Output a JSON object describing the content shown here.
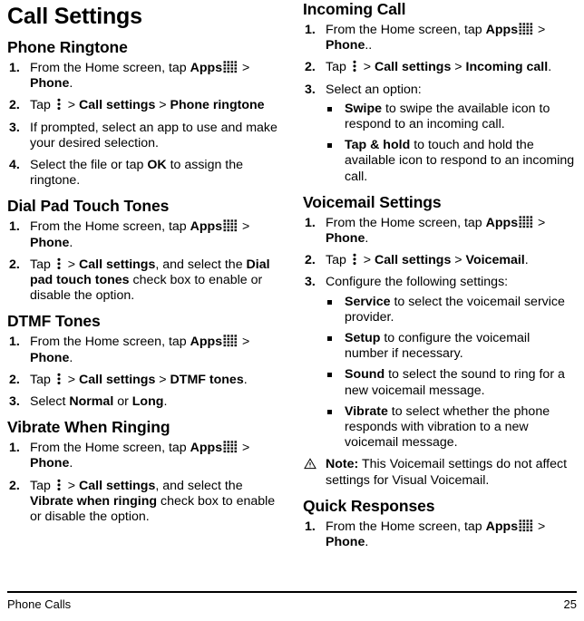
{
  "document": {
    "title": "Call Settings",
    "footer_left": "Phone Calls",
    "footer_page": "25"
  },
  "icons": {
    "apps": "apps-grid-icon",
    "menu": "overflow-menu-icon",
    "note": "warning-triangle-icon"
  },
  "left_column": {
    "sections": [
      {
        "heading": "Phone Ringtone",
        "steps": [
          {
            "num": "1.",
            "parts": [
              {
                "t": "From the Home screen, tap ",
                "b": false
              },
              {
                "t": "Apps",
                "b": true
              },
              {
                "icon": "apps"
              },
              {
                "t": " > ",
                "b": false
              },
              {
                "t": "Phone",
                "b": true
              },
              {
                "t": ".",
                "b": false
              }
            ]
          },
          {
            "num": "2.",
            "parts": [
              {
                "t": "Tap ",
                "b": false
              },
              {
                "icon": "menu"
              },
              {
                "t": " > ",
                "b": false
              },
              {
                "t": "Call settings",
                "b": true
              },
              {
                "t": " > ",
                "b": false
              },
              {
                "t": "Phone ringtone",
                "b": true
              }
            ]
          },
          {
            "num": "3.",
            "parts": [
              {
                "t": "If prompted, select an app to use and make your desired selection.",
                "b": false
              }
            ]
          },
          {
            "num": "4.",
            "parts": [
              {
                "t": "Select the file or tap ",
                "b": false
              },
              {
                "t": "OK",
                "b": true
              },
              {
                "t": " to assign the ringtone.",
                "b": false
              }
            ]
          }
        ]
      },
      {
        "heading": "Dial Pad Touch Tones",
        "steps": [
          {
            "num": "1.",
            "parts": [
              {
                "t": "From the Home screen, tap ",
                "b": false
              },
              {
                "t": "Apps",
                "b": true
              },
              {
                "icon": "apps"
              },
              {
                "t": " > ",
                "b": false
              },
              {
                "t": "Phone",
                "b": true
              },
              {
                "t": ".",
                "b": false
              }
            ]
          },
          {
            "num": "2.",
            "parts": [
              {
                "t": "Tap ",
                "b": false
              },
              {
                "icon": "menu"
              },
              {
                "t": " > ",
                "b": false
              },
              {
                "t": "Call settings",
                "b": true
              },
              {
                "t": ", and select the ",
                "b": false
              },
              {
                "t": "Dial pad touch tones",
                "b": true
              },
              {
                "t": " check box to enable or disable the option.",
                "b": false
              }
            ]
          }
        ]
      },
      {
        "heading": "DTMF Tones",
        "steps": [
          {
            "num": "1.",
            "parts": [
              {
                "t": "From the Home screen, tap ",
                "b": false
              },
              {
                "t": "Apps",
                "b": true
              },
              {
                "icon": "apps"
              },
              {
                "t": " > ",
                "b": false
              },
              {
                "t": "Phone",
                "b": true
              },
              {
                "t": ".",
                "b": false
              }
            ]
          },
          {
            "num": "2.",
            "parts": [
              {
                "t": "Tap ",
                "b": false
              },
              {
                "icon": "menu"
              },
              {
                "t": " > ",
                "b": false
              },
              {
                "t": "Call settings",
                "b": true
              },
              {
                "t": " > ",
                "b": false
              },
              {
                "t": "DTMF tones",
                "b": true
              },
              {
                "t": ".",
                "b": false
              }
            ]
          },
          {
            "num": "3.",
            "parts": [
              {
                "t": "Select ",
                "b": false
              },
              {
                "t": "Normal",
                "b": true
              },
              {
                "t": " or ",
                "b": false
              },
              {
                "t": "Long",
                "b": true
              },
              {
                "t": ".",
                "b": false
              }
            ]
          }
        ]
      },
      {
        "heading": "Vibrate When Ringing",
        "steps": [
          {
            "num": "1.",
            "parts": [
              {
                "t": "From the Home screen, tap ",
                "b": false
              },
              {
                "t": "Apps",
                "b": true
              },
              {
                "icon": "apps"
              },
              {
                "t": " > ",
                "b": false
              },
              {
                "t": "Phone",
                "b": true
              },
              {
                "t": ".",
                "b": false
              }
            ]
          },
          {
            "num": "2.",
            "parts": [
              {
                "t": "Tap ",
                "b": false
              },
              {
                "icon": "menu"
              },
              {
                "t": " > ",
                "b": false
              },
              {
                "t": "Call settings",
                "b": true
              },
              {
                "t": ", and select the ",
                "b": false
              },
              {
                "t": "Vibrate when ringing",
                "b": true
              },
              {
                "t": " check box to enable or disable the option.",
                "b": false
              }
            ]
          }
        ]
      }
    ]
  },
  "right_column": {
    "sections": [
      {
        "heading": "Incoming Call",
        "steps": [
          {
            "num": "1.",
            "parts": [
              {
                "t": "From the Home screen, tap ",
                "b": false
              },
              {
                "t": "Apps",
                "b": true
              },
              {
                "icon": "apps"
              },
              {
                "t": " > ",
                "b": false
              },
              {
                "t": "Phone",
                "b": true
              },
              {
                "t": "..",
                "b": false
              }
            ]
          },
          {
            "num": "2.",
            "parts": [
              {
                "t": "Tap ",
                "b": false
              },
              {
                "icon": "menu"
              },
              {
                "t": " > ",
                "b": false
              },
              {
                "t": "Call settings",
                "b": true
              },
              {
                "t": " > ",
                "b": false
              },
              {
                "t": "Incoming call",
                "b": true
              },
              {
                "t": ".",
                "b": false
              }
            ]
          },
          {
            "num": "3.",
            "parts": [
              {
                "t": "Select an option:",
                "b": false
              }
            ],
            "subs": [
              {
                "parts": [
                  {
                    "t": "Swipe",
                    "b": true
                  },
                  {
                    "t": " to swipe the available icon to respond to an incoming call.",
                    "b": false
                  }
                ]
              },
              {
                "parts": [
                  {
                    "t": "Tap & hold",
                    "b": true
                  },
                  {
                    "t": " to touch and hold the available icon to respond to an incoming call.",
                    "b": false
                  }
                ]
              }
            ]
          }
        ]
      },
      {
        "heading": "Voicemail Settings",
        "steps": [
          {
            "num": "1.",
            "parts": [
              {
                "t": "From the Home screen, tap ",
                "b": false
              },
              {
                "t": "Apps",
                "b": true
              },
              {
                "icon": "apps"
              },
              {
                "t": " > ",
                "b": false
              },
              {
                "t": "Phone",
                "b": true
              },
              {
                "t": ".",
                "b": false
              }
            ]
          },
          {
            "num": "2.",
            "parts": [
              {
                "t": "Tap ",
                "b": false
              },
              {
                "icon": "menu"
              },
              {
                "t": " > ",
                "b": false
              },
              {
                "t": "Call settings",
                "b": true
              },
              {
                "t": " > ",
                "b": false
              },
              {
                "t": "Voicemail",
                "b": true
              },
              {
                "t": ".",
                "b": false
              }
            ]
          },
          {
            "num": "3.",
            "parts": [
              {
                "t": "Configure the following settings:",
                "b": false
              }
            ],
            "subs": [
              {
                "parts": [
                  {
                    "t": "Service",
                    "b": true
                  },
                  {
                    "t": " to select the voicemail service provider.",
                    "b": false
                  }
                ]
              },
              {
                "parts": [
                  {
                    "t": "Setup",
                    "b": true
                  },
                  {
                    "t": " to configure the voicemail number if necessary.",
                    "b": false
                  }
                ]
              },
              {
                "parts": [
                  {
                    "t": "Sound",
                    "b": true
                  },
                  {
                    "t": " to select the sound to ring for a new voicemail message.",
                    "b": false
                  }
                ]
              },
              {
                "parts": [
                  {
                    "t": "Vibrate",
                    "b": true
                  },
                  {
                    "t": " to select whether the phone responds with vibration to a new voicemail message.",
                    "b": false
                  }
                ]
              }
            ]
          }
        ],
        "note": {
          "parts": [
            {
              "t": "Note:",
              "b": true
            },
            {
              "t": " This Voicemail settings do not affect settings for Visual Voicemail.",
              "b": false
            }
          ]
        }
      },
      {
        "heading": "Quick Responses",
        "steps": [
          {
            "num": "1.",
            "parts": [
              {
                "t": "From the Home screen, tap ",
                "b": false
              },
              {
                "t": "Apps",
                "b": true
              },
              {
                "icon": "apps"
              },
              {
                "t": " > ",
                "b": false
              },
              {
                "t": "Phone",
                "b": true
              },
              {
                "t": ".",
                "b": false
              }
            ]
          }
        ]
      }
    ]
  }
}
